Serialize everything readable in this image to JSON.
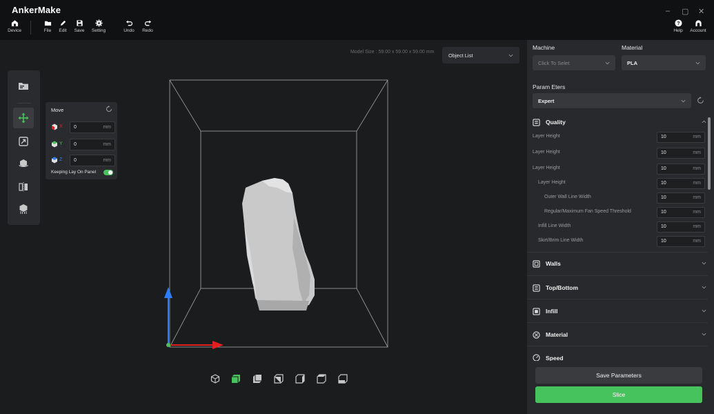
{
  "app": {
    "brand": "AnkerMake"
  },
  "toolbar": {
    "items": [
      {
        "label": "Device",
        "icon": "device-icon"
      },
      {
        "label": "File",
        "icon": "folder-icon"
      },
      {
        "label": "Edit",
        "icon": "pencil-icon"
      },
      {
        "label": "Save",
        "icon": "save-icon"
      },
      {
        "label": "Setting",
        "icon": "gear-icon"
      },
      {
        "label": "Undo",
        "icon": "undo-icon"
      },
      {
        "label": "Redo",
        "icon": "redo-icon"
      }
    ],
    "help": "Help",
    "account": "Account"
  },
  "window_controls": {
    "minimize": "–",
    "maximize": "▢",
    "close": "✕"
  },
  "viewport": {
    "model_size": "Model Size : 59.00 x 59.00 x 59.00 mm",
    "object_list": "Object List"
  },
  "left_tools": [
    "folder-icon",
    "move-icon",
    "scale-icon",
    "rotate-icon",
    "mirror-icon",
    "support-icon"
  ],
  "move_panel": {
    "title": "Move",
    "x": {
      "label": "X",
      "value": "0",
      "unit": "mm"
    },
    "y": {
      "label": "Y",
      "value": "0",
      "unit": "mm"
    },
    "z": {
      "label": "Z",
      "value": "0",
      "unit": "mm"
    },
    "lay_on_panel": "Keeping Lay On Panel",
    "lay_on_panel_enabled": true
  },
  "right_panel": {
    "machine_label": "Machine",
    "machine_value": "Click To Selet",
    "material_label": "Material",
    "material_value": "PLA",
    "params_label": "Param Eters",
    "params_value": "Expert",
    "quality": {
      "title": "Quality",
      "rows": [
        {
          "label": "Layer Height",
          "value": "10",
          "unit": "mm"
        },
        {
          "label": "Layer Height",
          "value": "10",
          "unit": "mm"
        },
        {
          "label": "Layer Height",
          "value": "10",
          "unit": "mm"
        },
        {
          "label": "Layer Height",
          "value": "10",
          "unit": "mm"
        },
        {
          "label": "Outer Wall Line Width",
          "value": "10",
          "unit": "mm"
        },
        {
          "label": "Regular/Maximum Fan Speed Threshold",
          "value": "10",
          "unit": "mm"
        },
        {
          "label": "Infill Line Width",
          "value": "10",
          "unit": "mm"
        },
        {
          "label": "Skirt/Brim Line Width",
          "value": "10",
          "unit": "mm"
        }
      ]
    },
    "sections": [
      "Walls",
      "Top/Bottom",
      "Infill",
      "Material",
      "Speed"
    ],
    "save_button": "Save Parameters",
    "slice_button": "Slice"
  },
  "colors": {
    "accent": "#46c35c",
    "axis_x": "#e62020",
    "axis_y": "#46c35c",
    "axis_z": "#2f7df6"
  }
}
